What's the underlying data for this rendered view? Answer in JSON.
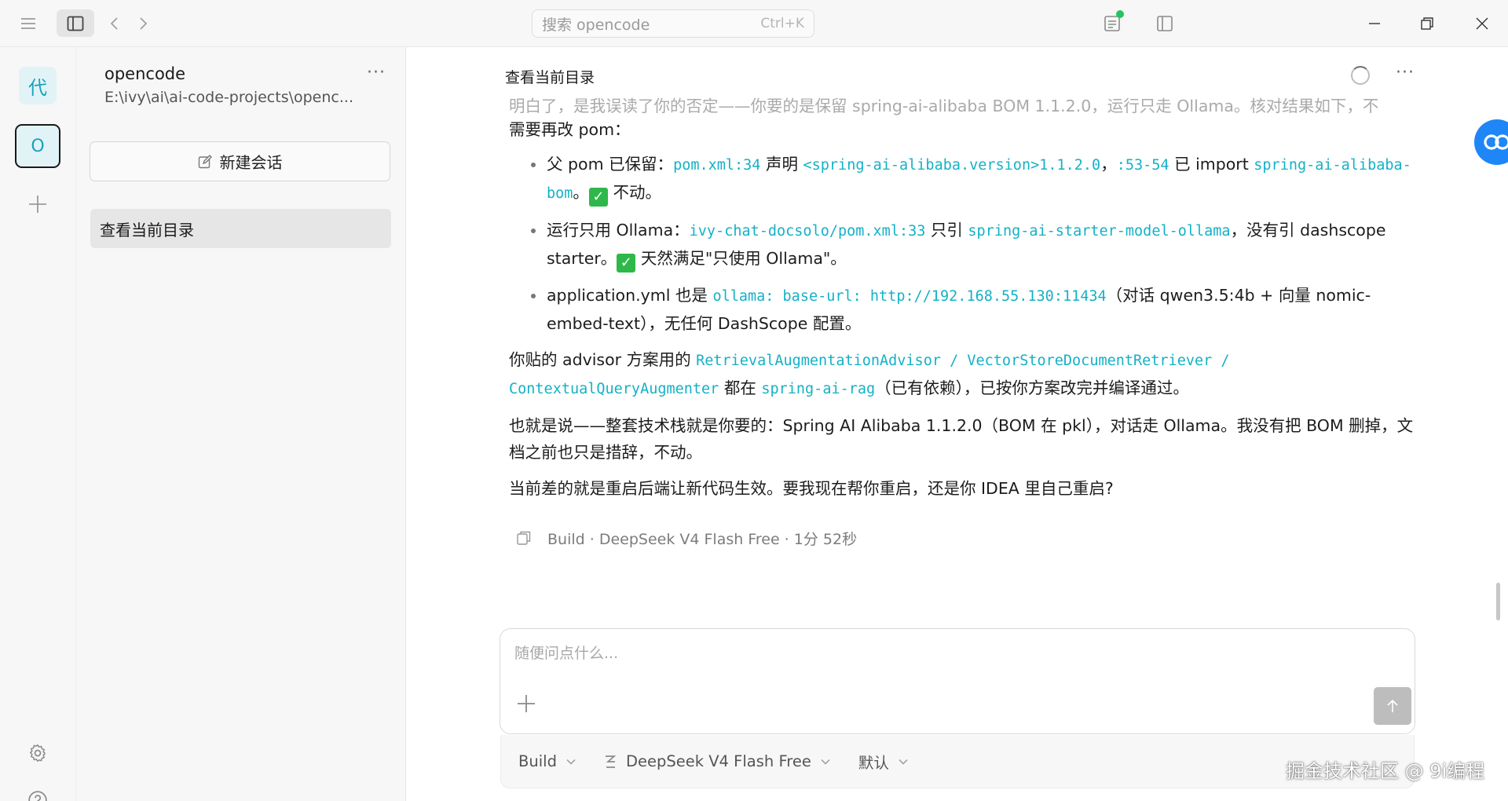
{
  "titlebar": {
    "search_placeholder": "搜索 opencode",
    "search_shortcut": "Ctrl+K"
  },
  "rail": {
    "workspaces": [
      {
        "label": "代"
      },
      {
        "label": "O"
      }
    ]
  },
  "sidebar": {
    "project_name": "opencode",
    "project_path": "E:\\ivy\\ai\\ai-code-projects\\openc...",
    "more_label": "···",
    "new_session_label": "新建会话",
    "sessions": [
      {
        "label": "查看当前目录"
      }
    ]
  },
  "main": {
    "title": "查看当前目录",
    "more_label": "···",
    "message": {
      "faded_line": "明白了，是我误读了你的否定——你要的是保留 spring-ai-alibaba BOM 1.1.2.0，运行只走 Ollama。核对结果如下，不",
      "intro_line": "需要再改 pom：",
      "b1": {
        "t1": "父 pom 已保留：",
        "c1": "pom.xml:34",
        "t2": " 声明 ",
        "c2": "<spring-ai-alibaba.version>1.1.2.0",
        "t3": "，",
        "c3": ":53-54",
        "t4": " 已 import ",
        "c4": "spring-ai-alibaba-bom",
        "t5": "。",
        "t6": " 不动。"
      },
      "b2": {
        "t1": "运行只用 Ollama：",
        "c1": "ivy-chat-docsolo/pom.xml:33",
        "t2": " 只引 ",
        "c2": "spring-ai-starter-model-ollama",
        "t3": "，没有引 dashscope starter。",
        "t4": " 天然满足\"只使用 Ollama\"。"
      },
      "b3": {
        "t1": "application.yml 也是 ",
        "c1": "ollama: base-url: http://192.168.55.130:11434",
        "t2": "（对话 qwen3.5:4b + 向量 nomic-embed-text），无任何 DashScope 配置。"
      },
      "p1": {
        "t1": "你贴的 advisor 方案用的 ",
        "c1": "RetrievalAugmentationAdvisor / VectorStoreDocumentRetriever / ContextualQueryAugmenter",
        "t2": " 都在 ",
        "c2": "spring-ai-rag",
        "t3": "（已有依赖），已按你方案改完并编译通过。"
      },
      "p2": "也就是说——整套技术栈就是你要的：Spring AI Alibaba 1.1.2.0（BOM 在 pkl），对话走 Ollama。我没有把 BOM 删掉，文档之前也只是措辞，不动。",
      "p3": "当前差的就是重启后端让新代码生效。要我现在帮你重启，还是你 IDEA 里自己重启?"
    },
    "meta": "Build · DeepSeek V4 Flash Free · 1分 52秒",
    "composer_placeholder": "随便问点什么...",
    "toolbar": {
      "agent": "Build",
      "model": "DeepSeek V4 Flash Free",
      "variant": "默认"
    }
  },
  "watermark": "掘金技术社区 @ 9i编程",
  "colors": {
    "accent_code": "#14b1c7",
    "status_dot": "#22c55e",
    "check": "#2eb84a"
  }
}
